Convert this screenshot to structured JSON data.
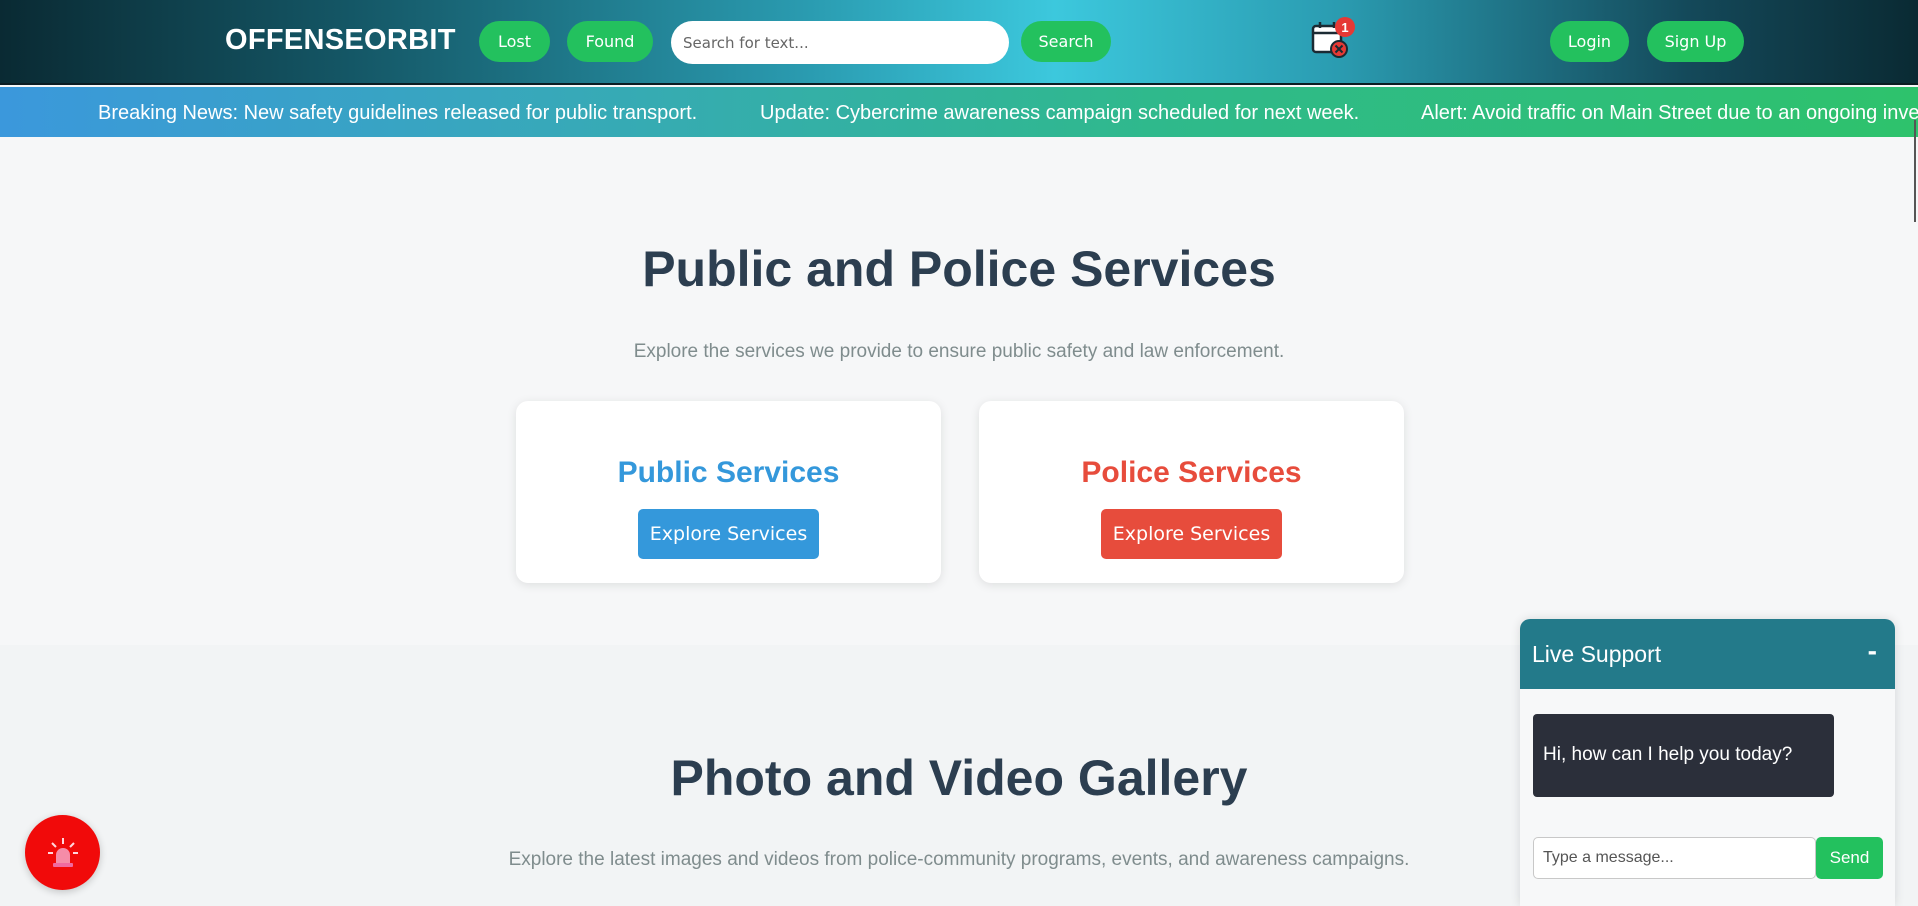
{
  "header": {
    "brand": "OFFENSEORBIT",
    "lost_label": "Lost",
    "found_label": "Found",
    "search_placeholder": "Search for text...",
    "search_label": "Search",
    "notification_count": "1",
    "notification_icon": "calendar-cancel-icon",
    "login_label": "Login",
    "signup_label": "Sign Up"
  },
  "ticker": {
    "items": [
      "Breaking News: New safety guidelines released for public transport.",
      "Update: Cybercrime awareness campaign scheduled for next week.",
      "Alert: Avoid traffic on Main Street due to an ongoing inve"
    ]
  },
  "services": {
    "title": "Public and Police Services",
    "subtitle": "Explore the services we provide to ensure public safety and law enforcement.",
    "cards": [
      {
        "title": "Public Services",
        "button": "Explore Services",
        "color": "#3498db"
      },
      {
        "title": "Police Services",
        "button": "Explore Services",
        "color": "#e74c3c"
      }
    ]
  },
  "gallery": {
    "title": "Photo and Video Gallery",
    "subtitle": "Explore the latest images and videos from police-community programs, events, and awareness campaigns."
  },
  "emergency": {
    "icon": "siren-icon"
  },
  "chat": {
    "title": "Live Support",
    "minimize": "-",
    "message": "Hi, how can I help you today?",
    "input_placeholder": "Type a message...",
    "send_label": "Send"
  },
  "colors": {
    "green": "#23c15e",
    "chat_header": "#237a8a",
    "heading": "#2c3e50",
    "emergency": "#f10a0a"
  }
}
